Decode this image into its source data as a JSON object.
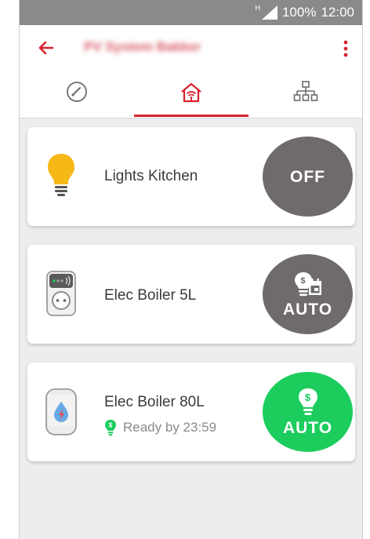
{
  "status_bar": {
    "network": "H",
    "battery": "100%",
    "time": "12:00"
  },
  "header": {
    "title": "PV System Bakker"
  },
  "tabs": [
    {
      "name": "dashboard",
      "icon": "gauge-icon",
      "active": false
    },
    {
      "name": "home",
      "icon": "home-wifi-icon",
      "active": true
    },
    {
      "name": "network",
      "icon": "network-tree-icon",
      "active": false
    }
  ],
  "devices": [
    {
      "name": "Lights Kitchen",
      "icon": "lightbulb-icon",
      "button_label": "OFF",
      "button_icon": "",
      "button_color": "#6f6b6a"
    },
    {
      "name": "Elec Boiler 5L",
      "icon": "smart-plug-icon",
      "button_label": "AUTO",
      "button_icon": "solar-schedule-icon",
      "button_color": "#6f6b6a"
    },
    {
      "name": "Elec Boiler 80L",
      "icon": "water-heater-icon",
      "status": "Ready by 23:59",
      "button_label": "AUTO",
      "button_icon": "solar-bulb-icon",
      "button_color": "#1ccd5e"
    }
  ],
  "colors": {
    "accent": "#d9232f",
    "green": "#1ccd5e",
    "grey_button": "#6f6b6a",
    "background": "#ededed"
  }
}
